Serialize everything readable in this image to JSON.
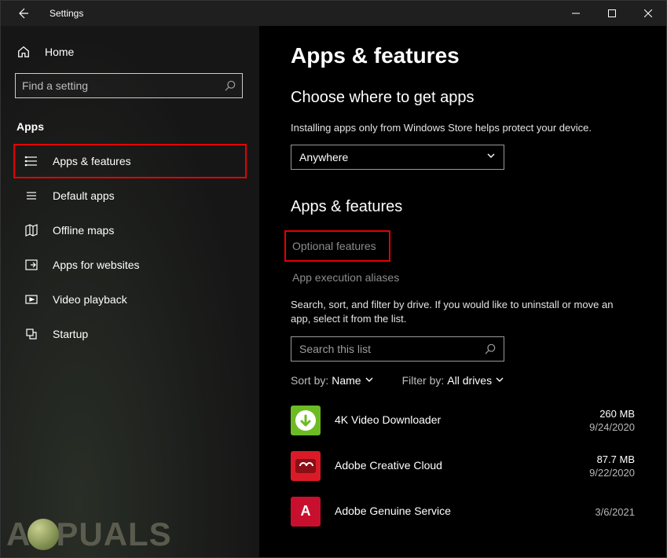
{
  "titlebar": {
    "title": "Settings"
  },
  "sidebar": {
    "home": "Home",
    "search_placeholder": "Find a setting",
    "section": "Apps",
    "items": [
      {
        "label": "Apps & features",
        "icon": "apps-features-icon",
        "highlighted": true
      },
      {
        "label": "Default apps",
        "icon": "default-apps-icon"
      },
      {
        "label": "Offline maps",
        "icon": "offline-maps-icon"
      },
      {
        "label": "Apps for websites",
        "icon": "apps-websites-icon"
      },
      {
        "label": "Video playback",
        "icon": "video-playback-icon"
      },
      {
        "label": "Startup",
        "icon": "startup-icon"
      }
    ]
  },
  "main": {
    "title": "Apps & features",
    "choose_title": "Choose where to get apps",
    "choose_desc": "Installing apps only from Windows Store helps protect your device.",
    "source_select": "Anywhere",
    "section2_title": "Apps & features",
    "optional_features": "Optional features",
    "app_exec_aliases": "App execution aliases",
    "list_desc": "Search, sort, and filter by drive. If you would like to uninstall or move an app, select it from the list.",
    "list_search_placeholder": "Search this list",
    "sort_label": "Sort by:",
    "sort_value": "Name",
    "filter_label": "Filter by:",
    "filter_value": "All drives",
    "apps": [
      {
        "name": "4K Video Downloader",
        "size": "260 MB",
        "date": "9/24/2020",
        "icon_class": "icon-4k",
        "glyph": "⬇"
      },
      {
        "name": "Adobe Creative Cloud",
        "size": "87.7 MB",
        "date": "9/22/2020",
        "icon_class": "icon-cc",
        "glyph": "∞"
      },
      {
        "name": "Adobe Genuine Service",
        "size": "",
        "date": "3/6/2021",
        "icon_class": "icon-ag",
        "glyph": "A"
      }
    ]
  },
  "watermark": "A   PUALS"
}
